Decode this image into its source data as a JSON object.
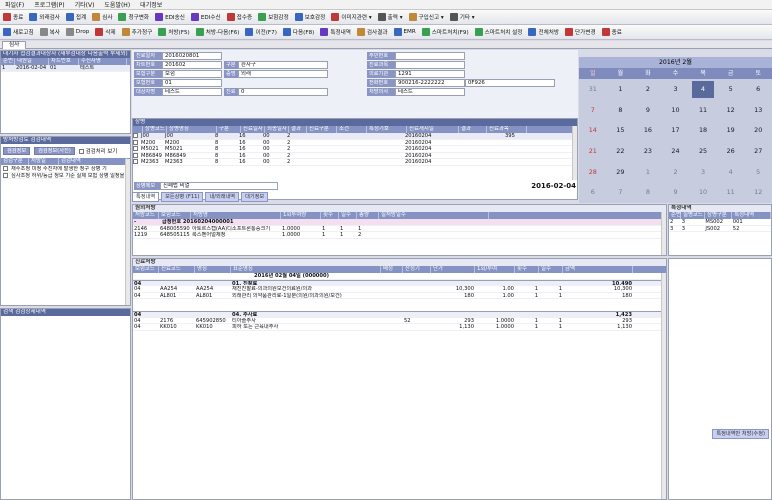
{
  "menu": [
    "파일(F)",
    "프로그램(P)",
    "기타(V)",
    "도움말(H)",
    "대기정보"
  ],
  "toolbar1": [
    {
      "label": "종료",
      "color": "#c03838"
    },
    {
      "label": "외래검사",
      "color": "#3867c0"
    },
    {
      "label": "접계",
      "color": "#3867c0"
    },
    {
      "label": "심사",
      "color": "#c08838"
    },
    {
      "label": "청구변화",
      "color": "#38a050"
    },
    {
      "label": "EDI송신",
      "color": "#6838c0"
    },
    {
      "label": "EDI수신",
      "color": "#6838c0"
    },
    {
      "label": "접수증",
      "color": "#c03838"
    },
    {
      "label": "보험감정",
      "color": "#38a050"
    },
    {
      "label": "보호감정",
      "color": "#3867c0"
    },
    {
      "label": "이미지관련 ▾",
      "color": "#c03838"
    },
    {
      "label": "출력 ▾",
      "color": "#555555"
    },
    {
      "label": "구입신고 ▾",
      "color": "#c08838"
    },
    {
      "label": "기타 ▾",
      "color": "#555555"
    }
  ],
  "toolbar2": [
    {
      "label": "새로고침",
      "color": "#3867c0"
    },
    {
      "label": "복사",
      "color": "#888888"
    },
    {
      "label": "Drop",
      "color": "#888888"
    },
    {
      "label": "삭제",
      "color": "#c03838"
    },
    {
      "label": "추가청구",
      "color": "#c08838"
    },
    {
      "label": "처방(F5)",
      "color": "#38a050"
    },
    {
      "label": "처방-다음(F6)",
      "color": "#38a050"
    },
    {
      "label": "이전(F7)",
      "color": "#3867c0"
    },
    {
      "label": "다음(F8)",
      "color": "#3867c0"
    },
    {
      "label": "특정내역",
      "color": "#6838c0"
    },
    {
      "label": "검사결과",
      "color": "#c08838"
    },
    {
      "label": "EMR",
      "color": "#3867c0"
    },
    {
      "label": "스마트처치(F9)",
      "color": "#38a050"
    },
    {
      "label": "스마트처치 설정",
      "color": "#38a050"
    },
    {
      "label": "전체처방",
      "color": "#3867c0"
    },
    {
      "label": "단가변경",
      "color": "#c03838"
    },
    {
      "label": "종료",
      "color": "#c03838"
    }
  ],
  "tab": "심사",
  "left": {
    "waiting_header": "대기자  접검결과대상자  (재부검대상 다음출력 부제외)",
    "waiting_cols": [
      "순번",
      "내원일",
      "차트번호",
      "수진자명"
    ],
    "waiting_rows": [
      [
        "1",
        "2016-02-04",
        "01",
        "테스트"
      ]
    ],
    "history_header": "방처방검토  검검내역",
    "history_tabs": [
      "검검정보",
      "검검정보(사진)",
      "검검처리 보기"
    ],
    "history_cols": [
      "검검구분",
      "처방일",
      "검검내역"
    ],
    "notes": [
      "재수조정   미청 수진자에 발생한 청구 상병 기",
      "심사조정 하위/등급 정보 기준 실제 보험 상병 일정을 확인"
    ],
    "bottom_header": "검색  검검상세내역"
  },
  "patient": {
    "fields": [
      {
        "label": "진료일자",
        "value": "2016020801"
      },
      {
        "label": "차트번호",
        "value": "201602",
        "extra_label": "구분",
        "extra_value": "환자구"
      },
      {
        "label": "보험구분",
        "value": "보험",
        "extra_label": "증명",
        "extra_value": "외래"
      },
      {
        "label": "보험번호",
        "value": "01"
      },
      {
        "label": "대상자명",
        "value": "테스트",
        "extra_label": "진료",
        "extra_value": "0"
      }
    ],
    "right_fields": [
      {
        "label": "주민번호",
        "value": ""
      },
      {
        "label": "진료과목",
        "value": ""
      },
      {
        "label": "의료기관",
        "value": "1291"
      },
      {
        "label": "전화번호",
        "value": "900216-2222222",
        "extra_value": "0F926"
      },
      {
        "label": "처방의사",
        "value": "테스트"
      }
    ]
  },
  "disease": {
    "header": "상병",
    "cols": [
      "",
      "상병코드",
      "상병명칭",
      "구분",
      "진료일자",
      "최종일자",
      "결과",
      "진료구분",
      "조건",
      "특정기호",
      "진료개시일",
      "결과",
      "진료과목"
    ],
    "rows": [
      [
        "J00",
        "J00",
        "8",
        "16",
        "00",
        "2",
        "20160204",
        "395"
      ],
      [
        "M200",
        "M200",
        "8",
        "16",
        "00",
        "2",
        "20160204",
        ""
      ],
      [
        "M5021",
        "M5021",
        "8",
        "16",
        "00",
        "2",
        "20160204",
        ""
      ],
      [
        "M86849",
        "M86849",
        "8",
        "16",
        "00",
        "2",
        "20160204",
        ""
      ],
      [
        "M2363",
        "M2363",
        "8",
        "16",
        "00",
        "2",
        "20160204",
        ""
      ]
    ],
    "memo_label": "상병메모",
    "memo_value": "진폐법 비열",
    "date": "2016-02-04",
    "tabs": [
      "특정내역",
      "모든상병 (F11)",
      "내/외래내역",
      "대기정보"
    ]
  },
  "hospital": {
    "header": "원외처방",
    "cols": [
      "처방코드",
      "보험코드",
      "처방명",
      "1회투여량",
      "횟수",
      "일수",
      "총량",
      "실처방일수"
    ],
    "group": "급정번호  20160204000001",
    "rows": [
      [
        "2146",
        "648005590",
        "아토르스캡(AA)디소프트론통증크기",
        "1.0000",
        "1",
        "1",
        "1"
      ],
      [
        "1219",
        "648505115",
        "록스펜어얼제정",
        "1.0000",
        "1",
        "1",
        "2"
      ]
    ]
  },
  "special": {
    "header": "특정내역",
    "cols": [
      "순번",
      "질병코드",
      "상병구분",
      "특정내역"
    ],
    "rows": [
      [
        "2",
        "3",
        "MS002",
        "001"
      ],
      [
        "3",
        "3",
        "JS002",
        "52"
      ]
    ],
    "button": "특정내역만 처방(수정)"
  },
  "treatment": {
    "header": "진료처방",
    "cols": [
      "보험코드",
      "진료코드",
      "명칭",
      "표준명칭",
      "배정",
      "산정기",
      "단가",
      "1회/투여",
      "횟수",
      "일수",
      "금액"
    ],
    "group_title": "2016년 02월 04일 (000000)",
    "rows": [
      {
        "cells": [
          "04",
          "",
          "",
          "01. 진찰료",
          "",
          "",
          "",
          "",
          "",
          "",
          "10,490"
        ],
        "band": true
      },
      {
        "cells": [
          "04",
          "AA254",
          "AA254",
          "재진진찰료-의과의원보건의료원/의과",
          "",
          "",
          "10,300",
          "1.00",
          "1",
          "1",
          "10,300"
        ],
        "band": false
      },
      {
        "cells": [
          "04",
          "AL801",
          "AL801",
          "외래관리 의약품관리료-1일분(의원/의과의원/보건)",
          "",
          "",
          "180",
          "1.00",
          "1",
          "1",
          "180"
        ],
        "band": false
      },
      {
        "cells": [
          "04",
          "",
          "",
          "04. 주사료",
          "",
          "",
          "",
          "",
          "",
          "",
          "1,423"
        ],
        "band": true
      },
      {
        "cells": [
          "04",
          "2176",
          "645902850",
          "티아졸주사",
          "",
          "52",
          "293",
          "1.0000",
          "1",
          "1",
          "293"
        ],
        "band": false
      },
      {
        "cells": [
          "04",
          "KK010",
          "KK010",
          "피하 또는 근육내주사",
          "",
          "",
          "1,130",
          "1.0000",
          "1",
          "1",
          "1,130"
        ],
        "band": false
      }
    ]
  },
  "calendar": {
    "title": "2016년 2월",
    "dow": [
      "일",
      "월",
      "화",
      "수",
      "목",
      "금",
      "토"
    ],
    "days": [
      {
        "d": "31",
        "c": "other"
      },
      {
        "d": "1",
        "c": "norm"
      },
      {
        "d": "2",
        "c": "norm"
      },
      {
        "d": "3",
        "c": "norm"
      },
      {
        "d": "4",
        "c": "today"
      },
      {
        "d": "5",
        "c": "norm"
      },
      {
        "d": "6",
        "c": "norm"
      },
      {
        "d": "7",
        "c": "sun"
      },
      {
        "d": "8",
        "c": "norm"
      },
      {
        "d": "9",
        "c": "norm"
      },
      {
        "d": "10",
        "c": "norm"
      },
      {
        "d": "11",
        "c": "norm"
      },
      {
        "d": "12",
        "c": "norm"
      },
      {
        "d": "13",
        "c": "norm"
      },
      {
        "d": "14",
        "c": "sun"
      },
      {
        "d": "15",
        "c": "norm"
      },
      {
        "d": "16",
        "c": "norm"
      },
      {
        "d": "17",
        "c": "norm"
      },
      {
        "d": "18",
        "c": "norm"
      },
      {
        "d": "19",
        "c": "norm"
      },
      {
        "d": "20",
        "c": "norm"
      },
      {
        "d": "21",
        "c": "sun"
      },
      {
        "d": "22",
        "c": "norm"
      },
      {
        "d": "23",
        "c": "norm"
      },
      {
        "d": "24",
        "c": "norm"
      },
      {
        "d": "25",
        "c": "norm"
      },
      {
        "d": "26",
        "c": "norm"
      },
      {
        "d": "27",
        "c": "norm"
      },
      {
        "d": "28",
        "c": "sun"
      },
      {
        "d": "29",
        "c": "norm"
      },
      {
        "d": "1",
        "c": "other"
      },
      {
        "d": "2",
        "c": "other"
      },
      {
        "d": "3",
        "c": "other"
      },
      {
        "d": "4",
        "c": "other"
      },
      {
        "d": "5",
        "c": "other"
      },
      {
        "d": "6",
        "c": "other"
      },
      {
        "d": "7",
        "c": "other"
      },
      {
        "d": "8",
        "c": "other"
      },
      {
        "d": "9",
        "c": "other"
      },
      {
        "d": "10",
        "c": "other"
      },
      {
        "d": "11",
        "c": "other"
      },
      {
        "d": "12",
        "c": "other"
      }
    ],
    "colors": {
      "today": "#5b6a9c",
      "sun": "#c03838",
      "other": "#7a7a92",
      "norm": "#1a1a2a"
    }
  }
}
